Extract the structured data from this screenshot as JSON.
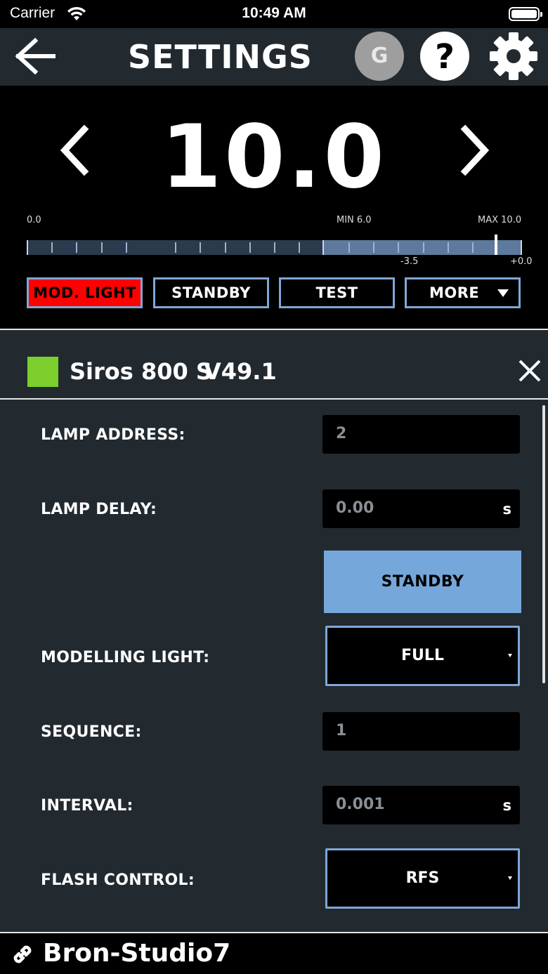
{
  "status_bar": {
    "carrier": "Carrier",
    "time": "10:49 AM",
    "icons": [
      "wifi-icon",
      "battery-icon"
    ]
  },
  "header": {
    "title": "SETTINGS",
    "avatar_letter": "G",
    "help_label": "?",
    "icons": [
      "back-arrow-icon",
      "help-icon",
      "gear-icon"
    ]
  },
  "power": {
    "value": "10.0",
    "scale": {
      "min_label": "0.0",
      "range_min_label": "MIN 6.0",
      "range_max_label": "MAX 10.0",
      "offset_low_label": "-3.5",
      "offset_high_label": "+0.0"
    },
    "buttons": {
      "mod_light": "MOD. LIGHT",
      "standby": "STANDBY",
      "test": "TEST",
      "more": "MORE"
    },
    "active_color": "#ff0000",
    "accent_color": "#7fa7d6"
  },
  "device": {
    "name": "Siros 800 S",
    "version": "V49.1",
    "status_color": "#7ccf2c",
    "settings": {
      "lamp_address_label": "LAMP ADDRESS:",
      "lamp_address_value": "2",
      "lamp_delay_label": "LAMP DELAY:",
      "lamp_delay_value": "0.00",
      "lamp_delay_unit": "s",
      "standby_button": "STANDBY",
      "modelling_light_label": "MODELLING LIGHT:",
      "modelling_light_value": "FULL",
      "sequence_label": "SEQUENCE:",
      "sequence_value": "1",
      "interval_label": "INTERVAL:",
      "interval_value": "0.001",
      "interval_unit": "s",
      "flash_control_label": "FLASH CONTROL:",
      "flash_control_value": "RFS"
    }
  },
  "footer": {
    "network_name": "Bron-Studio7",
    "icon": "link-icon"
  }
}
